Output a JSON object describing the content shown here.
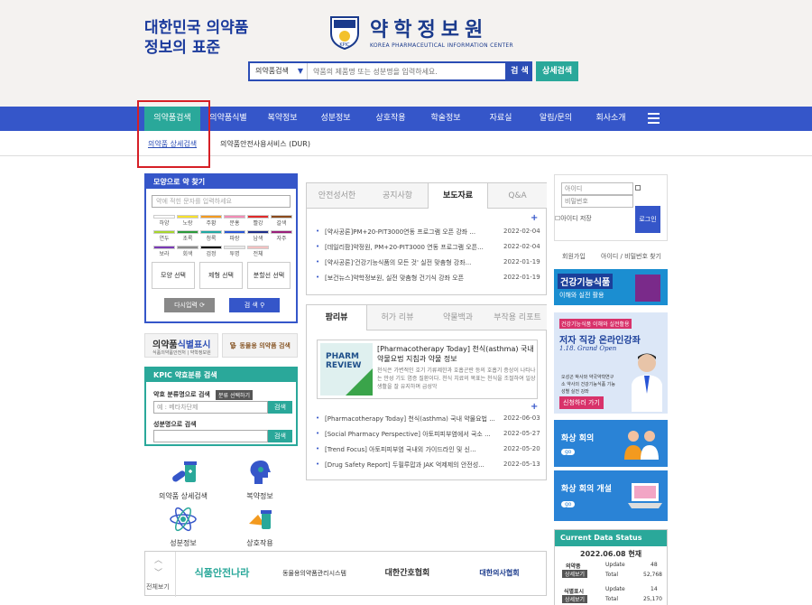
{
  "header": {
    "slogan": "대한민국 의약품정보의 표준",
    "logo_title": "약학정보원",
    "logo_sub": "KOREA PHARMACEUTICAL INFORMATION CENTER",
    "search_category": "의약품검색",
    "search_placeholder": "약품의 제품명 또는 성분명을 입력하세요.",
    "search_button": "검 색",
    "detail_search_button": "상세검색"
  },
  "nav": {
    "items": [
      "의약품검색",
      "의약품식별",
      "복약정보",
      "성분정보",
      "상호작용",
      "학술정보",
      "자료실",
      "알림/문의",
      "회사소개"
    ]
  },
  "subnav": {
    "items": [
      "의약품 상세검색",
      "의약품안전사용서비스 (DUR)"
    ]
  },
  "shape_search": {
    "title": "모양으로 약 찾기",
    "placeholder": "약에 적힌 문자를 입력하세요",
    "colors": [
      {
        "label": "하양",
        "hex": "#ffffff"
      },
      {
        "label": "노랑",
        "hex": "#f7e12b"
      },
      {
        "label": "주황",
        "hex": "#f39a1f"
      },
      {
        "label": "분홍",
        "hex": "#f28bb5"
      },
      {
        "label": "빨강",
        "hex": "#e02a2a"
      },
      {
        "label": "갈색",
        "hex": "#8b4a1c"
      },
      {
        "label": "연두",
        "hex": "#a7d62c"
      },
      {
        "label": "초록",
        "hex": "#2a9a3a"
      },
      {
        "label": "청록",
        "hex": "#1ea8a3"
      },
      {
        "label": "파랑",
        "hex": "#2855d6"
      },
      {
        "label": "남색",
        "hex": "#1c2d8a"
      },
      {
        "label": "자주",
        "hex": "#9a1f7a"
      },
      {
        "label": "보라",
        "hex": "#7a3ab5"
      },
      {
        "label": "회색",
        "hex": "#8a8a8a"
      },
      {
        "label": "검정",
        "hex": "#111111"
      },
      {
        "label": "투명",
        "hex": "#e8e8e8"
      },
      {
        "label": "전체",
        "hex": "#f3c1c1"
      }
    ],
    "shape_buttons": [
      "모양 선택",
      "제형 선택",
      "분할선 선택"
    ],
    "reset_button": "다시입력",
    "search_button": "검 색"
  },
  "banner_id": {
    "title_a": "의약품",
    "title_b": "식별표시",
    "sub": "식품의약품안전처 | 약학정보원"
  },
  "banner_animal": {
    "label": "동물용 의약품 검색"
  },
  "kpic_search": {
    "title": "KPIC 약효분류 검색",
    "label1": "약효 분류명으로 검색",
    "tag": "분류 선택하기",
    "placeholder1": "예 : 베타차단제",
    "button1": "검색",
    "label2": "성분명으로 검색",
    "button2": "검색"
  },
  "quick_links": [
    "의약품 상세검색",
    "복약정보",
    "성분정보",
    "상호작용"
  ],
  "panel1": {
    "tabs": [
      "안전성서한",
      "공지사항",
      "보도자료",
      "Q&A"
    ],
    "active_tab": "보도자료",
    "rows": [
      {
        "title": "[약사공론]PM+20-PIT3000연동 프로그램 오픈 강좌 ...",
        "date": "2022-02-04"
      },
      {
        "title": "[데일리팜]약정원, PM+20-PIT3000 연동 프로그램 오픈...",
        "date": "2022-02-04"
      },
      {
        "title": "[약사공론]'건강기능식품의 모든 것' 실전 맞춤형 강좌...",
        "date": "2022-01-19"
      },
      {
        "title": "[보건뉴스]약학정보원, 실전 맞춤형 건기식 강좌 오픈",
        "date": "2022-01-19"
      }
    ]
  },
  "panel2": {
    "tabs": [
      "팜리뷰",
      "허가 리뷰",
      "약물백과",
      "부작용 리포트"
    ],
    "active_tab": "팜리뷰",
    "feature_image_text": "PHARM REVIEW",
    "feature_title": "[Pharmacotherapy Today] 천식(asthma) 국내 약물요법 지침과 약물 정보",
    "feature_desc": "천식은 가변적인 호기 기류제한과 호흡곤란 등의 호흡기 증상이 나타나는 만성 기도 염증 질환이다. 천식 치료의 목표는 천식을 조절하여 일상생활을 잘 유지하며 급성악",
    "rows": [
      {
        "title": "[Pharmacotherapy Today] 천식(asthma) 국내 약물요법 ...",
        "date": "2022-06-03"
      },
      {
        "title": "[Social Pharmacy Perspective] 아토피피부염에서 국소 ...",
        "date": "2022-05-27"
      },
      {
        "title": "[Trend Focus] 아토피피부염 국내외 가이드라인 및 신...",
        "date": "2022-05-20"
      },
      {
        "title": "[Drug Safety Report] 두필루맙과 JAK 억제제의 안전성...",
        "date": "2022-05-13"
      }
    ]
  },
  "login": {
    "id_placeholder": "아이디",
    "pw_placeholder": "비밀번호",
    "save_id": "아이디 저장",
    "login_button": "로그인",
    "join": "회원가입",
    "find": "아이디 / 비밀번호 찾기"
  },
  "banner_health": {
    "title": "건강기능식품",
    "sub": "이해와 실전 활용"
  },
  "banner_lecture": {
    "label": "건강기능식품 이해와 실전활용",
    "title": "저자 직강 온라인강좌",
    "date": "1.18. Grand Open",
    "desc": "오성곤 박사와 약국약학연구소 약사의 건강기능식품 기능성별 실전 강좌",
    "cta": "신청하러 가기"
  },
  "banner_conf1": {
    "title": "화상 회의",
    "go": "go"
  },
  "banner_conf2": {
    "title": "화상 회의 개설",
    "go": "go"
  },
  "data_status": {
    "title": "Current Data Status",
    "date": "2022.06.08 현재",
    "rows": [
      {
        "cat": "의약품",
        "button": "상세보기",
        "k1": "Update",
        "v1": "48",
        "k2": "Total",
        "v2": "52,768"
      },
      {
        "cat": "식별표시",
        "button": "상세보기",
        "k1": "Update",
        "v1": "14",
        "k2": "Total",
        "v2": "25,170"
      }
    ]
  },
  "partners": {
    "view_all": "전체보기",
    "items": [
      "식품안전나라",
      "동물용의약품관리시스템",
      "대한간호협회",
      "대한의사협회"
    ]
  }
}
